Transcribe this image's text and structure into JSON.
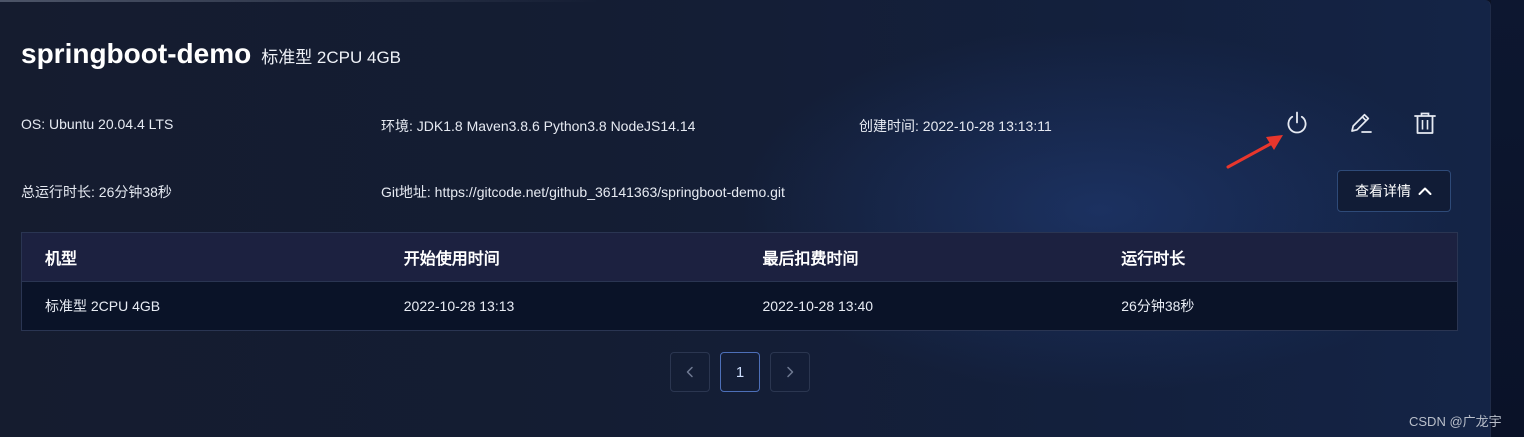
{
  "header": {
    "title": "springboot-demo",
    "spec": "标准型 2CPU 4GB"
  },
  "info": {
    "os": "OS: Ubuntu 20.04.4 LTS",
    "env": "环境: JDK1.8 Maven3.8.6 Python3.8 NodeJS14.14",
    "created": "创建时间: 2022-10-28 13:13:11",
    "total_runtime": "总运行时长: 26分钟38秒",
    "git": "Git地址: https://gitcode.net/github_36141363/springboot-demo.git"
  },
  "actions": {
    "power_icon": "power-icon",
    "edit_icon": "edit-icon",
    "delete_icon": "trash-icon",
    "annotation_color": "#e8362c"
  },
  "detail_button": {
    "label": "查看详情",
    "icon": "chevron-up-icon"
  },
  "table": {
    "columns": [
      "机型",
      "开始使用时间",
      "最后扣费时间",
      "运行时长"
    ],
    "rows": [
      [
        "标准型 2CPU 4GB",
        "2022-10-28 13:13",
        "2022-10-28 13:40",
        "26分钟38秒"
      ]
    ]
  },
  "pagination": {
    "prev_icon": "chevron-left-icon",
    "current_page": "1",
    "next_icon": "chevron-right-icon"
  },
  "watermark": "CSDN @广龙宇",
  "colors": {
    "background": "#141d33",
    "table_header": "#1c2140",
    "table_row": "#0a1328",
    "active_page_border": "#4d6fb8"
  }
}
